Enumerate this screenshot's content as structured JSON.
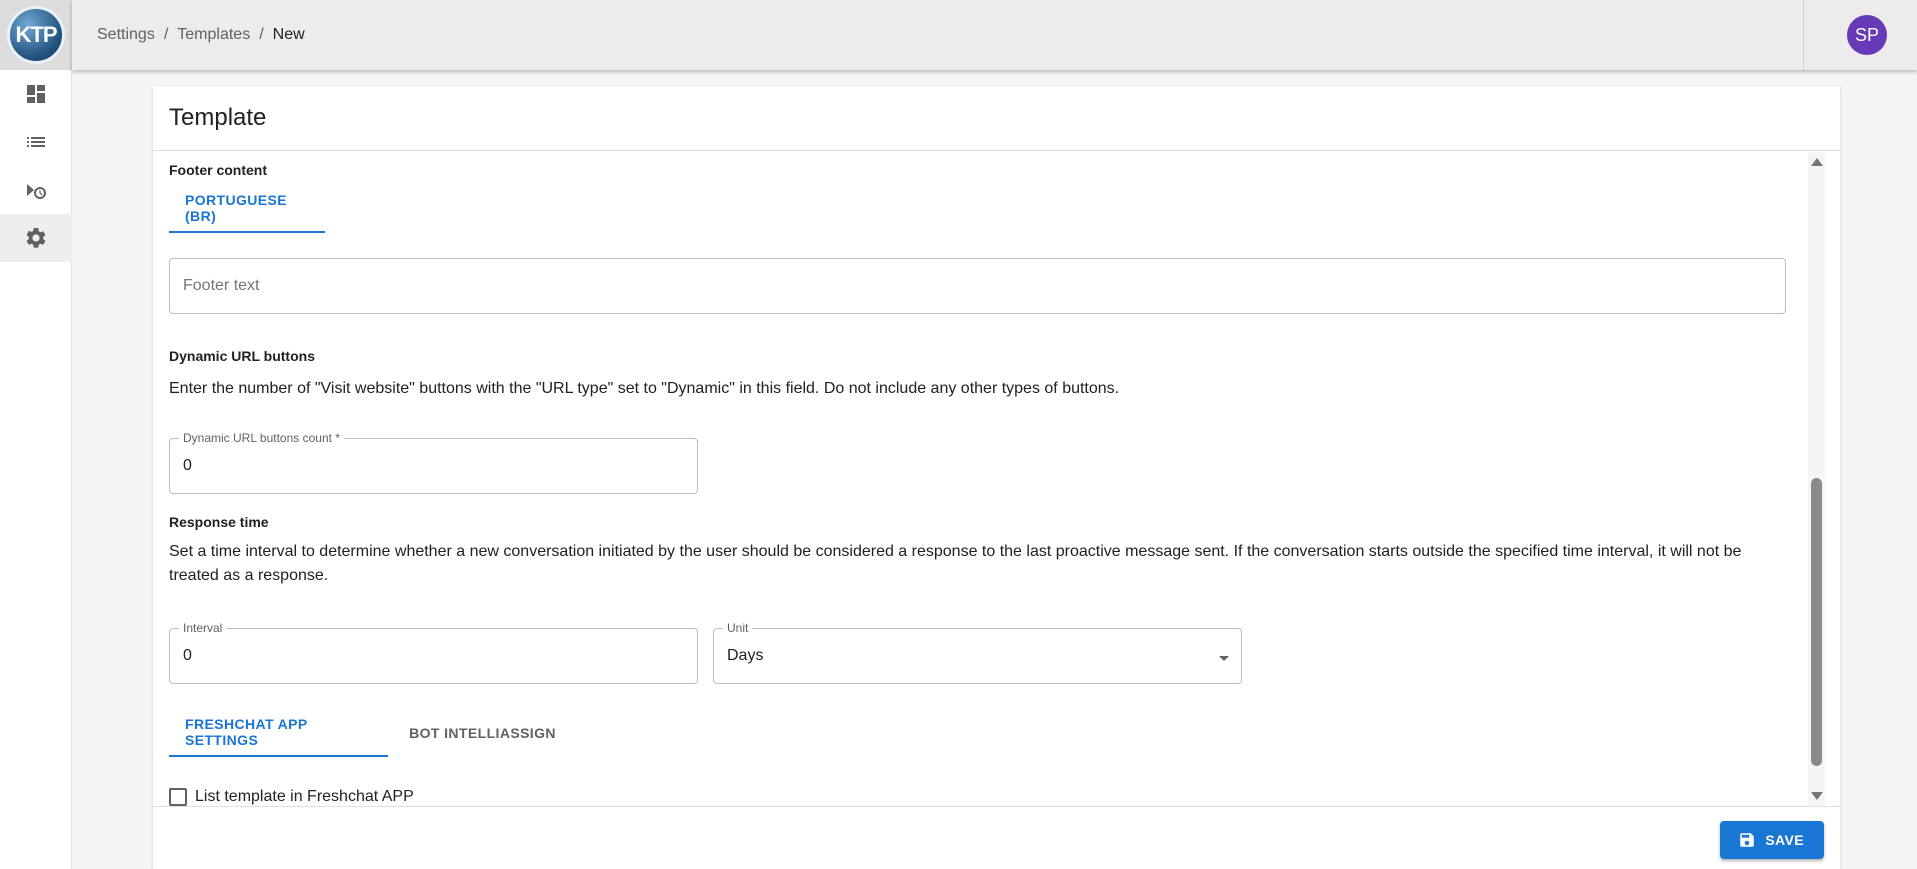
{
  "logo": {
    "text": "KTP"
  },
  "breadcrumb": {
    "items": [
      "Settings",
      "Templates"
    ],
    "current": "New",
    "separator": "/"
  },
  "user": {
    "initials": "SP",
    "avatar_color": "#673ab7"
  },
  "nav": [
    {
      "icon": "dashboard-icon"
    },
    {
      "icon": "list-icon"
    },
    {
      "icon": "campaign-schedule-icon"
    },
    {
      "icon": "settings-gear-icon",
      "active": true
    }
  ],
  "card": {
    "title": "Template"
  },
  "footer_content": {
    "title": "Footer content",
    "tab": "PORTUGUESE (BR)",
    "footer_text_placeholder": "Footer text"
  },
  "dynamic_url": {
    "title": "Dynamic URL buttons",
    "description": "Enter the number of \"Visit website\" buttons with the \"URL type\" set to \"Dynamic\" in this field. Do not include any other types of buttons.",
    "count_label": "Dynamic URL buttons count *",
    "count_value": "0"
  },
  "response_time": {
    "title": "Response time",
    "description": "Set a time interval to determine whether a new conversation initiated by the user should be considered a response to the last proactive message sent. If the conversation starts outside the specified time interval, it will not be treated as a response.",
    "interval_label": "Interval",
    "interval_value": "0",
    "unit_label": "Unit",
    "unit_value": "Days"
  },
  "app_tabs": [
    "FRESHCHAT APP SETTINGS",
    "BOT INTELLIASSIGN"
  ],
  "checkbox_label": "List template in Freshchat APP",
  "actions": {
    "save_label": "SAVE"
  },
  "colors": {
    "primary": "#1976d2",
    "topbar": "#ececec"
  }
}
